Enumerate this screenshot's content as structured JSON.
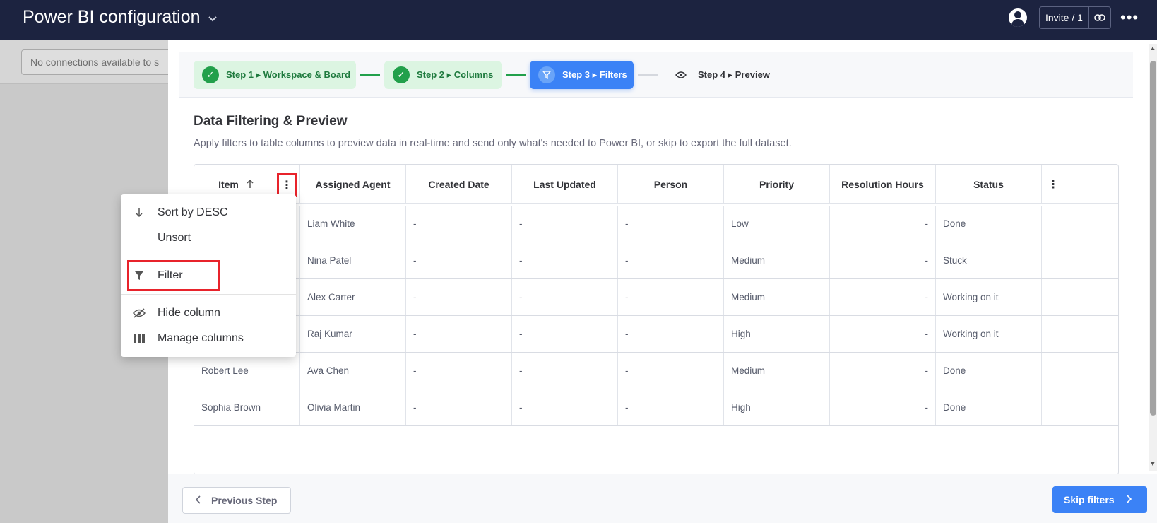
{
  "app": {
    "title": "Power BI configuration"
  },
  "header": {
    "invite_label": "Invite / 1"
  },
  "background": {
    "connection_placeholder": "No connections available to s"
  },
  "stepper": {
    "steps": [
      {
        "label": "Step 1 ▸ Workspace & Board",
        "state": "done"
      },
      {
        "label": "Step 2 ▸ Columns",
        "state": "done"
      },
      {
        "label": "Step 3 ▸ Filters",
        "state": "active"
      },
      {
        "label": "Step 4 ▸ Preview",
        "state": "todo"
      }
    ]
  },
  "section": {
    "title": "Data Filtering & Preview",
    "description": "Apply filters to table columns to preview data in real-time and send only what's needed to Power BI, or skip to export the full dataset."
  },
  "table": {
    "columns": [
      "Item",
      "Assigned Agent",
      "Created Date",
      "Last Updated",
      "Person",
      "Priority",
      "Resolution Hours",
      "Status"
    ],
    "rows": [
      [
        "",
        "Liam White",
        "-",
        "-",
        "-",
        "Low",
        "-",
        "Done"
      ],
      [
        "",
        "Nina Patel",
        "-",
        "-",
        "-",
        "Medium",
        "-",
        "Stuck"
      ],
      [
        "",
        "Alex Carter",
        "-",
        "-",
        "-",
        "Medium",
        "-",
        "Working on it"
      ],
      [
        "",
        "Raj Kumar",
        "-",
        "-",
        "-",
        "High",
        "-",
        "Working on it"
      ],
      [
        "Robert Lee",
        "Ava Chen",
        "-",
        "-",
        "-",
        "Medium",
        "-",
        "Done"
      ],
      [
        "Sophia Brown",
        "Olivia Martin",
        "-",
        "-",
        "-",
        "High",
        "-",
        "Done"
      ]
    ]
  },
  "context_menu": {
    "items": [
      {
        "label": "Sort by DESC",
        "icon": "arrow-down-icon"
      },
      {
        "label": "Unsort",
        "icon": ""
      },
      {
        "label": "Filter",
        "icon": "filter-icon"
      },
      {
        "label": "Hide column",
        "icon": "eye-off-icon"
      },
      {
        "label": "Manage columns",
        "icon": "columns-icon"
      }
    ]
  },
  "footer": {
    "previous_label": "Previous Step",
    "skip_label": "Skip filters"
  },
  "colors": {
    "topbar": "#1c2340",
    "accent": "#3b82f6",
    "success": "#22a04b",
    "highlight": "#e8232b"
  }
}
